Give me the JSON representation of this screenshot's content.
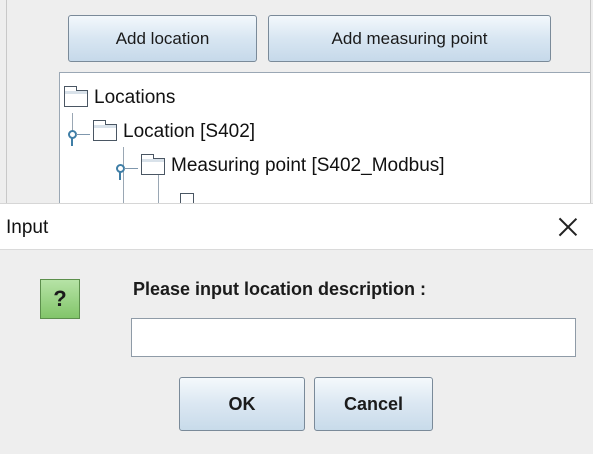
{
  "toolbar": {
    "add_location_label": "Add location",
    "add_measuring_point_label": "Add measuring point"
  },
  "tree": {
    "root_label": "Locations",
    "location_label": "Location [S402]",
    "measuring_point_label": "Measuring point [S402_Modbus]"
  },
  "dialog": {
    "title": "Input",
    "icon_glyph": "?",
    "message": "Please input location description :",
    "input_value": "",
    "ok_label": "OK",
    "cancel_label": "Cancel"
  },
  "colors": {
    "button_border": "#7a8a99",
    "tree_handle": "#3f7ea6",
    "question_icon": "#82c56a"
  }
}
